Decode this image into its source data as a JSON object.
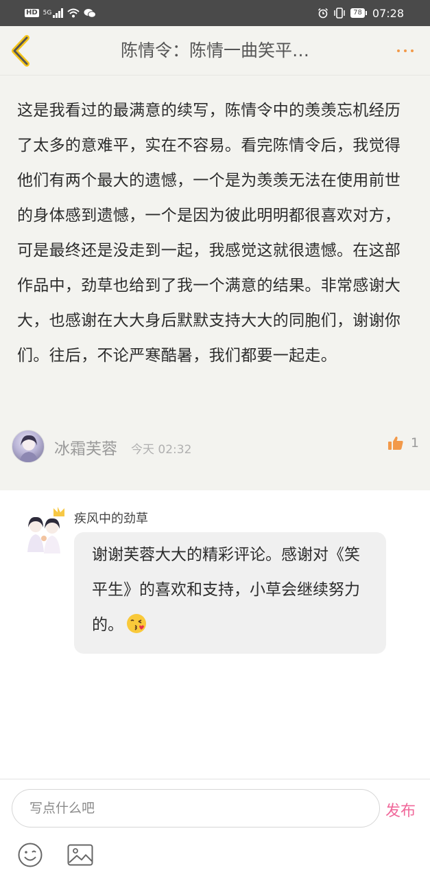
{
  "status_bar": {
    "hd": "HD",
    "network": "5G",
    "time": "07:28",
    "battery": "78"
  },
  "header": {
    "title": "陈情令：陈情一曲笑平…",
    "back_icon": "chevron-left-icon",
    "more_icon": "more-dots-icon",
    "accent_color": "#f2994a"
  },
  "comment": {
    "text": "这是我看过的最满意的续写，陈情令中的羡羡忘机经历了太多的意难平，实在不容易。看完陈情令后，我觉得他们有两个最大的遗憾，一个是为羡羡无法在使用前世的身体感到遗憾，一个是因为彼此明明都很喜欢对方，可是最终还是没走到一起，我感觉这就很遗憾。在这部作品中，劲草也给到了我一个满意的结果。非常感谢大大，也感谢在大大身后默默支持大大的同胞们，谢谢你们。往后，不论严寒酷暑，我们都要一起走。",
    "author": "冰霜芙蓉",
    "time": "今天 02:32",
    "likes": "1"
  },
  "reply": {
    "author": "疾风中的劲草",
    "text": "谢谢芙蓉大大的精彩评论。感谢对《笑平生》的喜欢和支持，小草会继续努力的。",
    "emoji": "kissing-face-emoji"
  },
  "bottom": {
    "input_placeholder": "写点什么吧",
    "publish_label": "发布",
    "publish_color": "#f0689a"
  }
}
